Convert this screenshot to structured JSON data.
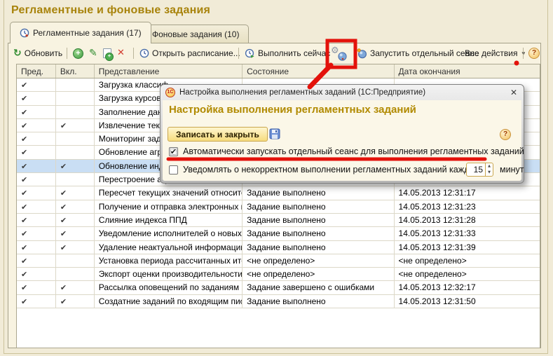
{
  "app": {
    "title": "Регламентные и фоновые задания"
  },
  "tabs": [
    {
      "label": "Регламентные задания (17)"
    },
    {
      "label": "Фоновые задания (10)"
    }
  ],
  "toolbar": {
    "refresh_label": "Обновить",
    "open_schedule_label": "Открыть расписание...",
    "run_now_label": "Выполнить сейчас",
    "run_separate_session_label": "Запустить отдельный сеанс",
    "all_actions_label": "Все действия"
  },
  "table": {
    "columns": [
      "Пред.",
      "Вкл.",
      "Представление",
      "Состояние",
      "Дата окончания"
    ],
    "rows": [
      {
        "pred": true,
        "vkl": false,
        "name": "Загрузка классиф",
        "state": "",
        "date": "",
        "selected": false
      },
      {
        "pred": true,
        "vkl": false,
        "name": "Загрузка курсов в",
        "state": "",
        "date": "",
        "selected": false
      },
      {
        "pred": true,
        "vkl": false,
        "name": "Заполнение данны",
        "state": "",
        "date": "",
        "selected": false
      },
      {
        "pred": true,
        "vkl": true,
        "name": "Извлечение текст",
        "state": "",
        "date": "",
        "selected": false
      },
      {
        "pred": true,
        "vkl": false,
        "name": "Мониторинг задач",
        "state": "",
        "date": "",
        "selected": false
      },
      {
        "pred": true,
        "vkl": false,
        "name": "Обновление агрег",
        "state": "",
        "date": "",
        "selected": false
      },
      {
        "pred": true,
        "vkl": true,
        "name": "Обновление инде",
        "state": "",
        "date": "",
        "selected": true
      },
      {
        "pred": true,
        "vkl": false,
        "name": "Перестроение агр",
        "state": "",
        "date": "",
        "selected": false
      },
      {
        "pred": true,
        "vkl": true,
        "name": "Пересчет текущих значений относител...",
        "state": "Задание выполнено",
        "date": "14.05.2013 12:31:17",
        "selected": false
      },
      {
        "pred": true,
        "vkl": true,
        "name": "Получение и отправка электронных пи...",
        "state": "Задание выполнено",
        "date": "14.05.2013 12:31:23",
        "selected": false
      },
      {
        "pred": true,
        "vkl": true,
        "name": "Слияние индекса ППД",
        "state": "Задание выполнено",
        "date": "14.05.2013 12:31:28",
        "selected": false
      },
      {
        "pred": true,
        "vkl": true,
        "name": "Уведомление исполнителей о новых з...",
        "state": "Задание выполнено",
        "date": "14.05.2013 12:31:33",
        "selected": false
      },
      {
        "pred": true,
        "vkl": true,
        "name": "Удаление неактуальной информации ...",
        "state": "Задание выполнено",
        "date": "14.05.2013 12:31:39",
        "selected": false
      },
      {
        "pred": true,
        "vkl": false,
        "name": "Установка периода рассчитанных ито...",
        "state": "<не определено>",
        "date": "<не определено>",
        "selected": false
      },
      {
        "pred": true,
        "vkl": false,
        "name": "Экспорт оценки производительности",
        "state": "<не определено>",
        "date": "<не определено>",
        "selected": false
      },
      {
        "pred": true,
        "vkl": true,
        "name": "Рассылка оповещений по заданиям",
        "state": "Задание завершено с ошибками",
        "date": "14.05.2013 12:32:17",
        "selected": false
      },
      {
        "pred": true,
        "vkl": true,
        "name": "Создатние заданий по входящим пись...",
        "state": "Задание выполнено",
        "date": "14.05.2013 12:31:50",
        "selected": false
      }
    ]
  },
  "dialog": {
    "titlebar": "Настройка выполнения регламентных заданий  (1С:Предприятие)",
    "logo_text": "1С",
    "heading": "Настройка выполнения регламентных заданий",
    "save_close_label": "Записать и закрыть",
    "auto_session_label": "Автоматически запускать отдельный сеанс для выполнения регламентных заданий",
    "auto_session_checked": true,
    "notify_label": "Уведомлять о некорректном выполнении регламентных заданий каждые:",
    "notify_checked": false,
    "interval_value": "15",
    "interval_unit": "минут"
  },
  "icons": {
    "check": "✔",
    "help": "?",
    "close": "✕",
    "dropdown": "▾",
    "up": "▲",
    "down": "▼"
  },
  "colors": {
    "accent_title": "#A8830B",
    "annotation_red": "#E3120B",
    "selected_row": "#C9DEF4"
  }
}
